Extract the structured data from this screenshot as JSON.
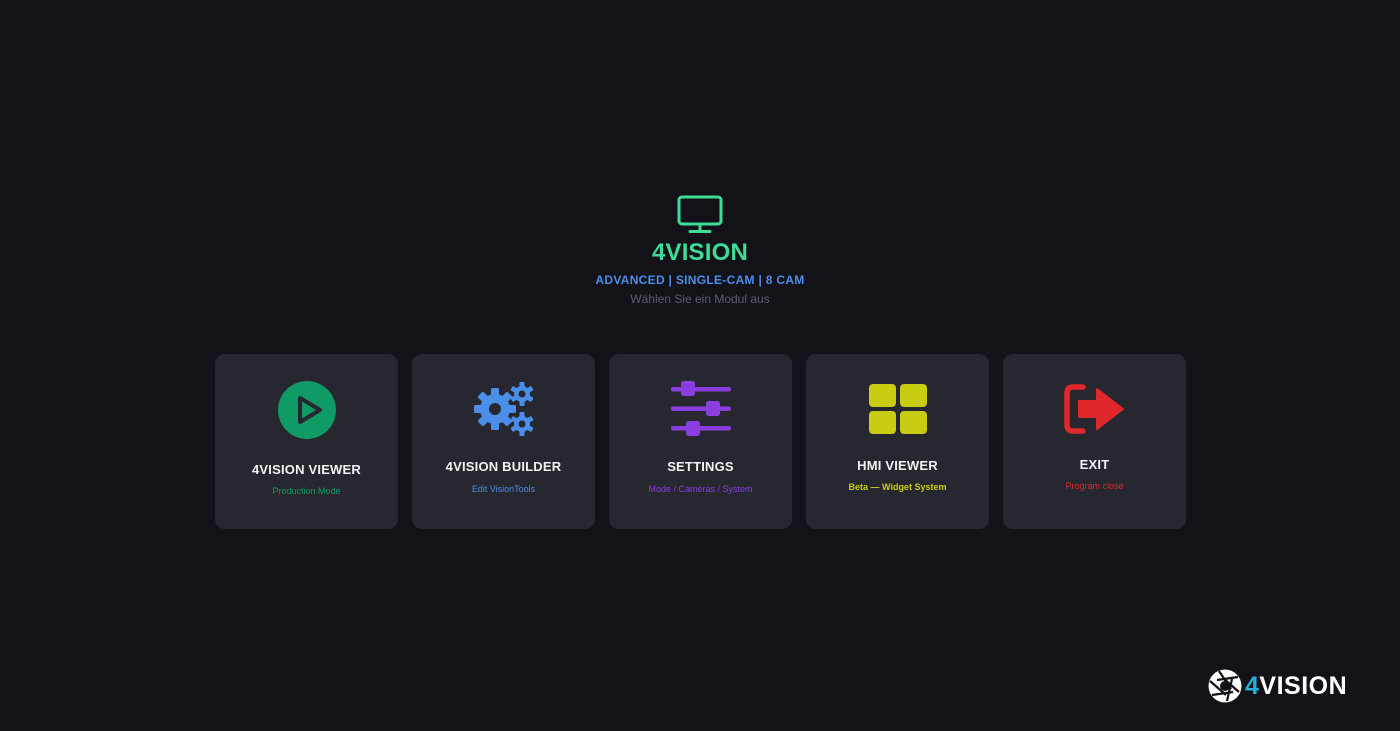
{
  "header": {
    "icon": "monitor-icon",
    "title": "4VISION",
    "edition": "ADVANCED | SINGLE-CAM | 8 CAM",
    "hint": "Wählen Sie ein Modul aus"
  },
  "modules": [
    {
      "label": "4VISION VIEWER",
      "subtitle": "Production Mode",
      "icon": "play-icon",
      "color": "#0f9a66"
    },
    {
      "label": "4VISION BUILDER",
      "subtitle": "Edit VisionTools",
      "icon": "gears-icon",
      "color": "#4a8eea"
    },
    {
      "label": "SETTINGS",
      "subtitle": "Mode / Cameras / System",
      "icon": "sliders-icon",
      "color": "#8a3ee0"
    },
    {
      "label": "HMI VIEWER",
      "subtitle": "Beta — Widget System",
      "icon": "grid-icon",
      "color": "#c9cd12"
    },
    {
      "label": "EXIT",
      "subtitle": "Program close",
      "icon": "exit-icon",
      "color": "#e0272b"
    }
  ],
  "brand": {
    "logo_icon": "aperture-icon",
    "prefix": "4",
    "name": "VISION"
  }
}
